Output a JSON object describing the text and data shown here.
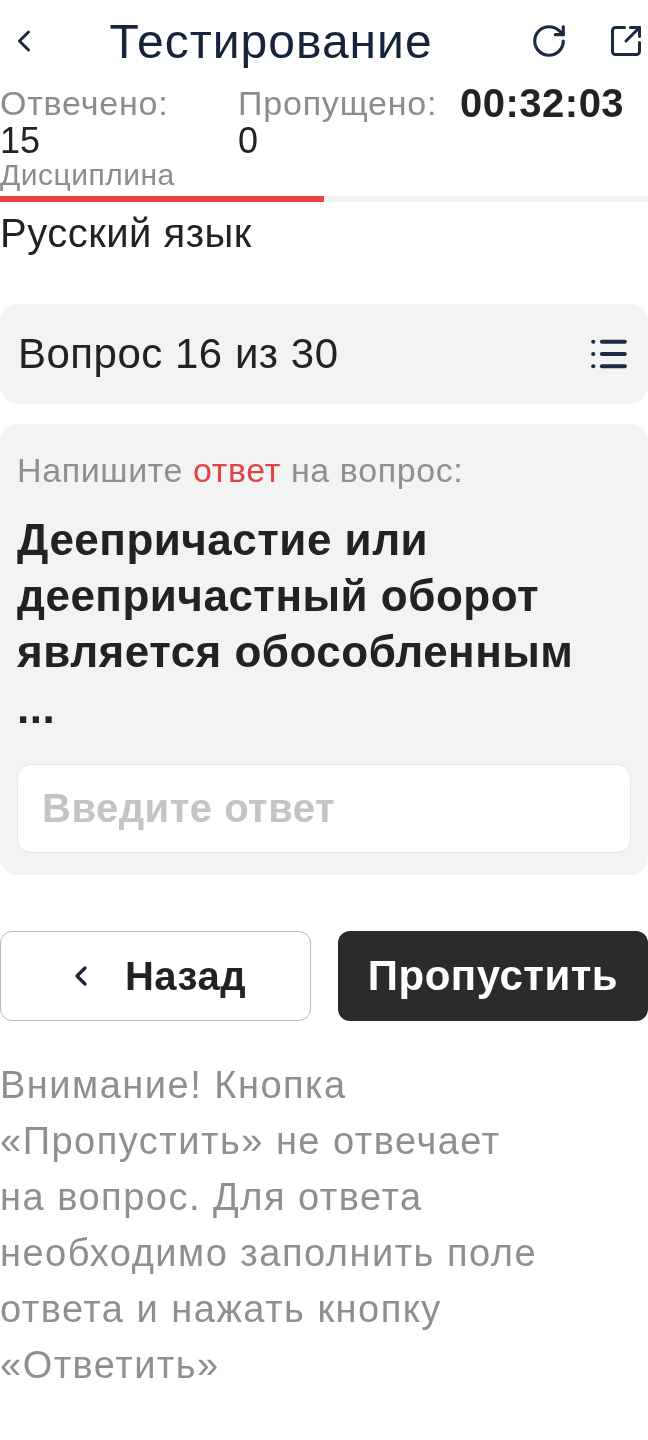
{
  "header": {
    "title": "Тестирование"
  },
  "stats": [
    {
      "label": "Отвечено:",
      "value": "15"
    },
    {
      "label": "Пропущено:",
      "value": "0"
    }
  ],
  "timer": "00:32:03",
  "discipline": {
    "label": "Дисциплина",
    "value": "Русский язык"
  },
  "progress": {
    "level": 0.5
  },
  "question_nav": {
    "title": "Вопрос 16 из 30"
  },
  "question": {
    "instruction": "Напишите **ответ** на вопрос:",
    "text": "Деепричастие или деепричастный оборот является обособленным ...",
    "answer_placeholder": "Введите ответ"
  },
  "buttons": [
    {
      "label": "Назад",
      "kind": "back"
    },
    {
      "label": "Пропустить",
      "kind": "primary"
    }
  ],
  "warning": "Внимание! Кнопка «Пропустить» не отвечает на вопрос. Для ответа необходимо заполнить поле ответа и нажать кнопку «Ответить»"
}
